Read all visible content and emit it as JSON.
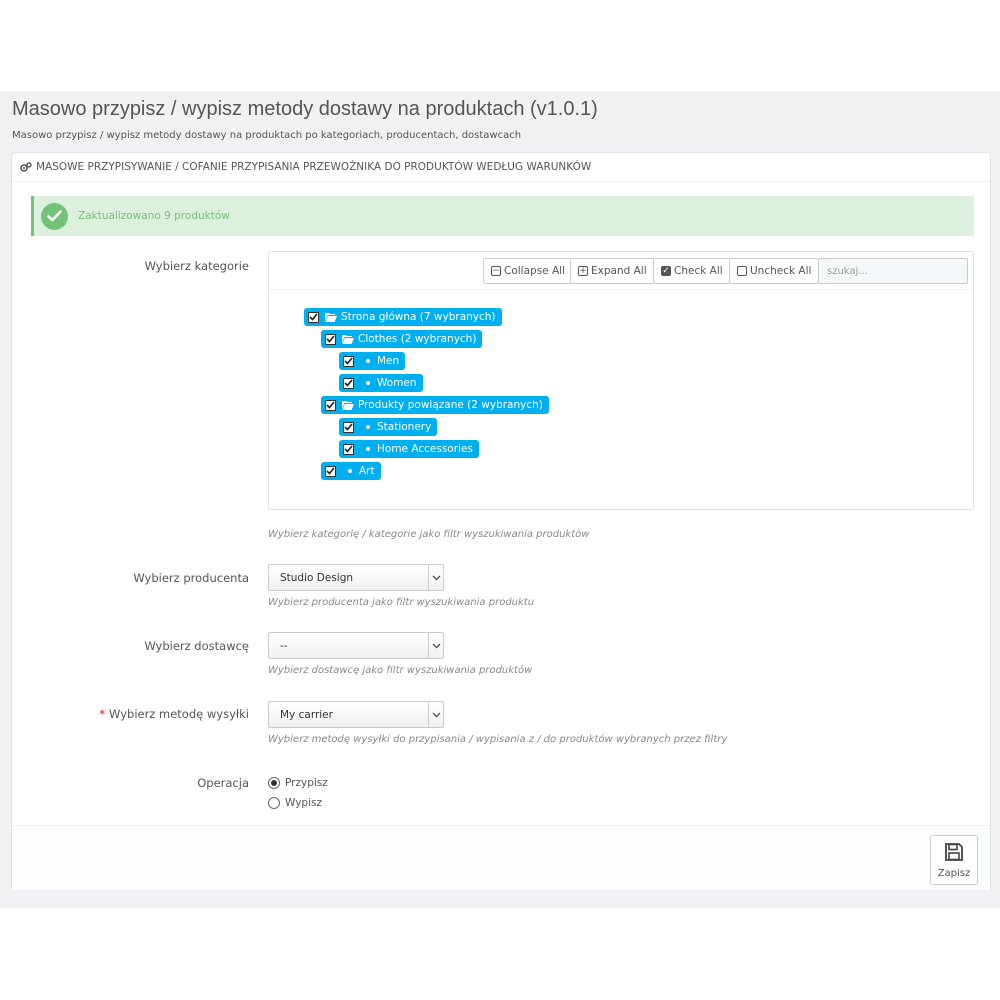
{
  "page": {
    "title": "Masowo przypisz / wypisz metody dostawy na produktach (v1.0.1)",
    "subtitle": "Masowo przypisz / wypisz metody dostawy na produktach po kategoriach, producentach, dostawcach"
  },
  "panel": {
    "heading": "Masowe przypisywanie / cofanie przypisania przewoźnika do produktów według warunków",
    "heading_icon": "gears-icon"
  },
  "alert": {
    "message": "Zaktualizowano 9 produktów",
    "icon": "check-circle-icon",
    "color": "#72c279"
  },
  "categories": {
    "label": "Wybierz kategorie",
    "toolbar": {
      "collapse_all": "Collapse All",
      "expand_all": "Expand All",
      "check_all": "Check All",
      "uncheck_all": "Uncheck All",
      "search_placeholder": "szukaj..."
    },
    "tree": [
      {
        "label": "Strona główna (7 wybranych)",
        "type": "folder",
        "checked": true
      },
      {
        "label": "Clothes (2 wybranych)",
        "type": "folder",
        "checked": true
      },
      {
        "label": "Men",
        "type": "leaf",
        "checked": true
      },
      {
        "label": "Women",
        "type": "leaf",
        "checked": true
      },
      {
        "label": "Produkty powiązane (2 wybranych)",
        "type": "folder",
        "checked": true
      },
      {
        "label": "Stationery",
        "type": "leaf",
        "checked": true
      },
      {
        "label": "Home Accessories",
        "type": "leaf",
        "checked": true
      },
      {
        "label": "Art",
        "type": "leaf",
        "checked": true
      }
    ],
    "help": "Wybierz kategorię / kategorie jako filtr wyszukiwania produktów",
    "accent_color": "#00aff0"
  },
  "manufacturer": {
    "label": "Wybierz producenta",
    "value": "Studio Design",
    "help": "Wybierz producenta jako filtr wyszukiwania produktu"
  },
  "supplier": {
    "label": "Wybierz dostawcę",
    "value": "--",
    "help": "Wybierz dostawcę jako filtr wyszukiwania produktów"
  },
  "carrier": {
    "label": "Wybierz metodę wysyłki",
    "required_mark": "*",
    "value": "My carrier",
    "help": "Wybierz metodę wysyłki do przypisania / wypisania z / do produktów wybranych przez filtry"
  },
  "operation": {
    "label": "Operacja",
    "options": [
      {
        "label": "Przypisz",
        "checked": true
      },
      {
        "label": "Wypisz",
        "checked": false
      }
    ]
  },
  "footer": {
    "save_label": "Zapisz",
    "save_icon": "floppy-disk-icon"
  }
}
